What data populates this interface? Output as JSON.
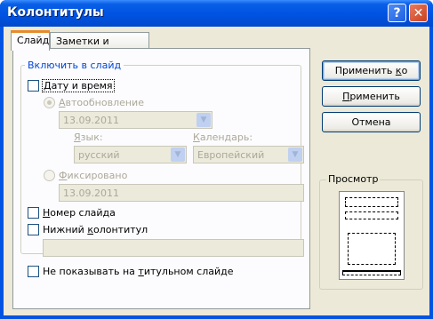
{
  "window": {
    "title": "Колонтитулы"
  },
  "titlebar_buttons": {
    "help": "?",
    "close": "✕"
  },
  "tabs": [
    {
      "label": "Слайд"
    },
    {
      "label": "Заметки и выдачи"
    }
  ],
  "include": {
    "group_label": "Включить в слайд",
    "date_time": {
      "label_pre": "",
      "label_ul": "Д",
      "label_post": "ату и время"
    },
    "auto_update": {
      "label_pre": "",
      "label_ul": "А",
      "label_post": "втообновление",
      "value": "13.09.2011"
    },
    "language": {
      "label_pre": "",
      "label_ul": "Я",
      "label_post": "зык:",
      "value": "русский"
    },
    "calendar": {
      "label_pre": "",
      "label_ul": "К",
      "label_post": "алендарь:",
      "value": "Европейский"
    },
    "fixed": {
      "label_pre": "",
      "label_ul": "Ф",
      "label_post": "иксировано",
      "value": "13.09.2011"
    },
    "slide_number": {
      "label_pre": "",
      "label_ul": "Н",
      "label_post": "омер слайда"
    },
    "footer": {
      "label_pre": "Нижний ",
      "label_ul": "к",
      "label_post": "олонтитул",
      "value": ""
    }
  },
  "dont_show_title": {
    "label_pre": "Не показывать на ",
    "label_ul": "т",
    "label_post": "итульном слайде"
  },
  "buttons": {
    "apply_all": {
      "pre": "Применить ",
      "ul": "к",
      "post": "о всем"
    },
    "apply": {
      "pre": "",
      "ul": "П",
      "post": "рименить"
    },
    "cancel": {
      "pre": "Отмена",
      "ul": "",
      "post": ""
    }
  },
  "preview": {
    "label": "Просмотр"
  },
  "icons": {
    "dropdown_arrow": "▼"
  }
}
